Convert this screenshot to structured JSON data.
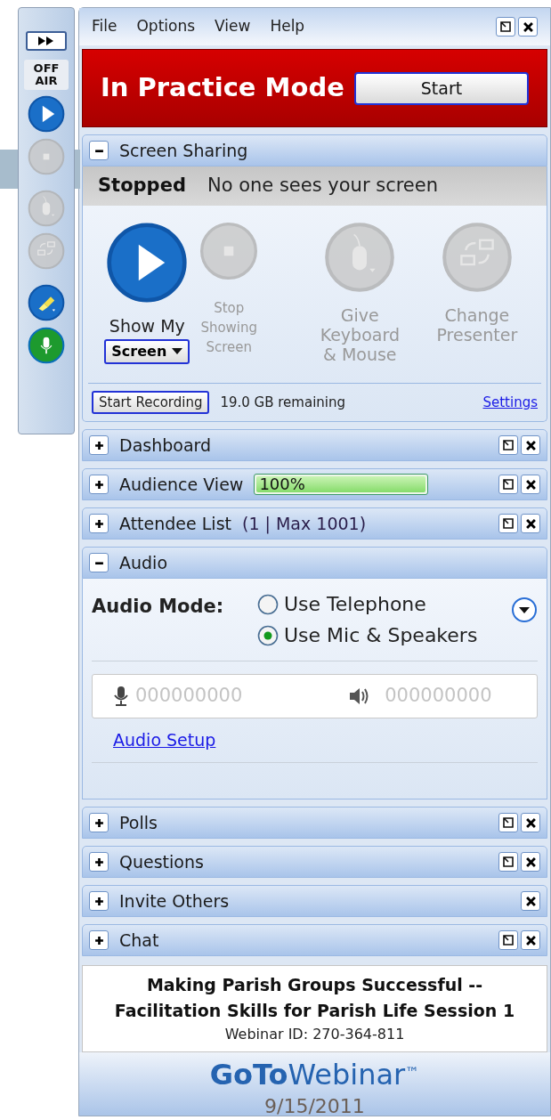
{
  "toolbar": {
    "on_air_label": "OFF\nAIR",
    "tools": [
      {
        "kind": "play",
        "enabled": true
      },
      {
        "kind": "stop",
        "enabled": false
      },
      {
        "kind": "mouse",
        "enabled": false
      },
      {
        "kind": "presenter",
        "enabled": false
      },
      {
        "kind": "draw",
        "enabled": true
      },
      {
        "kind": "mic",
        "enabled": true
      }
    ]
  },
  "menu": [
    "File",
    "Options",
    "View",
    "Help"
  ],
  "banner": {
    "title": "In Practice Mode",
    "button": "Start"
  },
  "screen_sharing": {
    "title": "Screen Sharing",
    "expanded": true,
    "status": "Stopped",
    "status_text": "No one sees your screen",
    "actions": [
      {
        "kind": "play",
        "label": "Show My",
        "enabled": true,
        "dropdown": "Screen"
      },
      {
        "kind": "stop",
        "label": "Stop\nShowing\nScreen",
        "enabled": false
      },
      {
        "kind": "mouse",
        "label": "Give\nKeyboard\n& Mouse",
        "enabled": false
      },
      {
        "kind": "presenter",
        "label": "Change\nPresenter",
        "enabled": false
      }
    ],
    "record_button": "Start Recording",
    "remaining": "19.0 GB remaining",
    "settings_link": "Settings"
  },
  "panels": [
    {
      "kind": "plain",
      "title": "Dashboard",
      "expanded": false,
      "popout": true,
      "close": true
    },
    {
      "kind": "meter",
      "title": "Audience View",
      "expanded": false,
      "popout": true,
      "close": true,
      "level": 1,
      "reading": "100%"
    },
    {
      "kind": "count",
      "title": "Attendee List",
      "expanded": false,
      "popout": true,
      "close": true,
      "count": "(1 | Max 1001)"
    },
    {
      "kind": "audio",
      "title": "Audio",
      "expanded": true,
      "popout": false,
      "close": false,
      "mode_label": "Audio Mode:",
      "options": [
        {
          "label": "Use Telephone",
          "selected": false
        },
        {
          "label": "Use Mic & Speakers",
          "selected": true
        }
      ],
      "mic_level": "000000000",
      "speaker_level": "000000000",
      "setup_link": "Audio Setup"
    },
    {
      "kind": "plain",
      "title": "Polls",
      "expanded": false,
      "popout": true,
      "close": true
    },
    {
      "kind": "plain",
      "title": "Questions",
      "expanded": false,
      "popout": true,
      "close": true
    },
    {
      "kind": "plain",
      "title": "Invite Others",
      "expanded": false,
      "popout": false,
      "close": true
    },
    {
      "kind": "plain",
      "title": "Chat",
      "expanded": false,
      "popout": true,
      "close": true
    }
  ],
  "footer": {
    "title": "Making Parish Groups Successful --\nFacilitation Skills for Parish Life Session 1",
    "webinar_id": "Webinar ID: 270-364-811"
  },
  "logo": {
    "bold": "GoTo",
    "light": "Webinar",
    "mark": "™"
  },
  "slide_date": "9/15/2011"
}
